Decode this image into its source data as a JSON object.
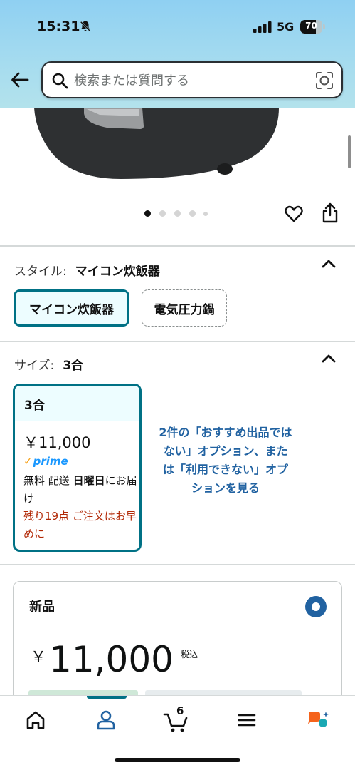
{
  "status_bar": {
    "time": "15:31",
    "network": "5G",
    "battery": "70",
    "battery_level": 0.7
  },
  "search": {
    "placeholder": "検索または質問する"
  },
  "product_images": {
    "total": 5,
    "current": 1
  },
  "style_section": {
    "label": "スタイル:",
    "value": "マイコン炊飯器",
    "options": [
      "マイコン炊飯器",
      "電気圧力鍋"
    ]
  },
  "size_section": {
    "label": "サイズ:",
    "value": "3合",
    "card": {
      "title": "3合",
      "price": "￥11,000",
      "prime": "prime",
      "delivery_prefix": "無料 配送",
      "delivery_day": "日曜日",
      "delivery_suffix": "にお届け",
      "stock": "残り19点 ご注文はお早めに"
    },
    "other_options": "2件の「おすすめ出品ではない」オプション、または「利用できない」オプションを見る"
  },
  "new_offer": {
    "title": "新品",
    "yen": "￥",
    "price": "11,000",
    "tax": "税込"
  },
  "bottom_nav": {
    "cart_count": "6"
  },
  "colors": {
    "accent": "#007185",
    "link": "#2162a1",
    "prime": "#1a98ff",
    "warning": "#b12704"
  }
}
